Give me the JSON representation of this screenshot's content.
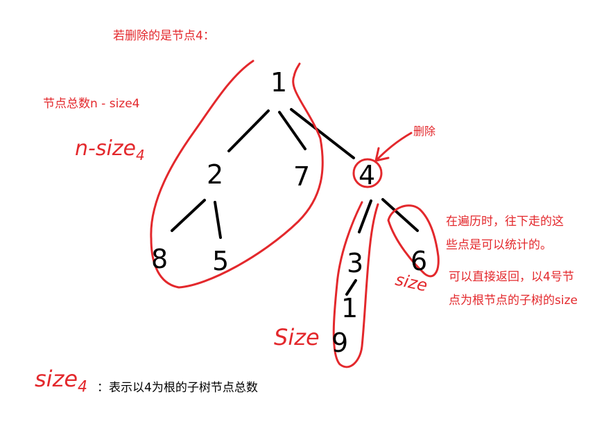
{
  "heading": "若删除的是节点4：",
  "remaining_label": "节点总数n - size4",
  "handwritten": {
    "n_minus": "n-size",
    "sub_4": "4",
    "size_right": "size",
    "size_left": "Size",
    "size_bottom": "size",
    "sub_4_bottom": "4"
  },
  "delete_label": "删除",
  "note_line1": "在遍历时，往下走的这",
  "note_line2": "些点是可以统计的。",
  "note_line3": "可以直接返回，以4号节",
  "note_line4": "点为根节点的子树的size",
  "legend_text": "：表示以4为根的子树节点总数",
  "nodes": [
    {
      "id": "1",
      "label": "1"
    },
    {
      "id": "2",
      "label": "2"
    },
    {
      "id": "7",
      "label": "7"
    },
    {
      "id": "4",
      "label": "4"
    },
    {
      "id": "8",
      "label": "8"
    },
    {
      "id": "5",
      "label": "5"
    },
    {
      "id": "3",
      "label": "3"
    },
    {
      "id": "6",
      "label": "6"
    },
    {
      "id": "1b",
      "label": "1"
    },
    {
      "id": "9",
      "label": "9"
    }
  ],
  "colors": {
    "annotation": "#e3282c",
    "tree": "#000000"
  }
}
